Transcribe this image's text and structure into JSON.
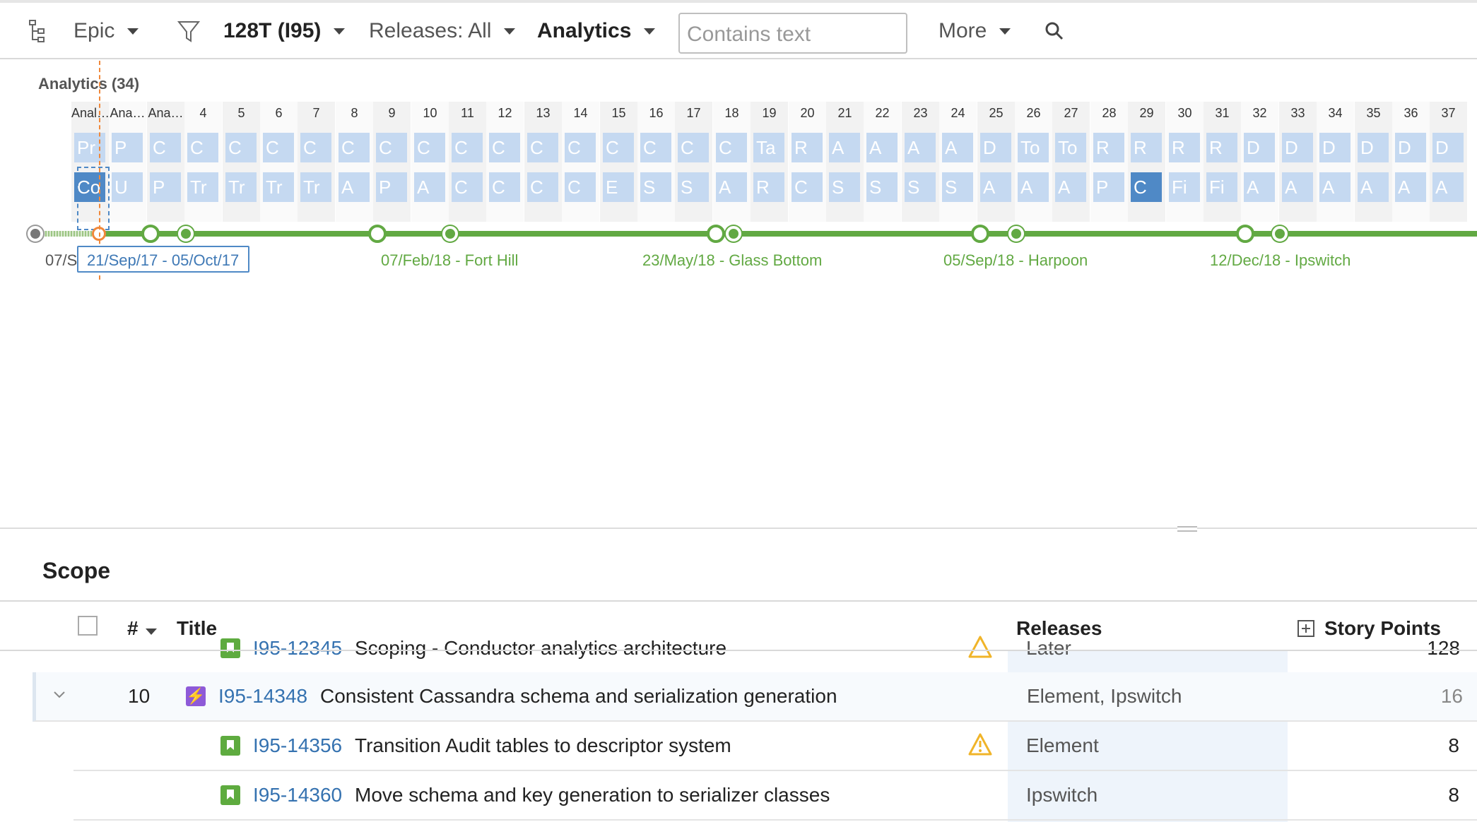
{
  "toolbar": {
    "hierarchy_icon": "hierarchy-icon",
    "epic_label": "Epic",
    "filter_icon": "funnel-icon",
    "project_label": "128T (I95)",
    "releases_label": "Releases: All",
    "team_label": "Analytics",
    "search_placeholder": "Contains text",
    "more_label": "More",
    "search_icon": "magnifier-icon"
  },
  "roadmap": {
    "title": "Analytics (34)",
    "columns": [
      "Anal…",
      "Ana…",
      "Ana…",
      "4",
      "5",
      "6",
      "7",
      "8",
      "9",
      "10",
      "11",
      "12",
      "13",
      "14",
      "15",
      "16",
      "17",
      "18",
      "19",
      "20",
      "21",
      "22",
      "23",
      "24",
      "25",
      "26",
      "27",
      "28",
      "29",
      "30",
      "31",
      "32",
      "33",
      "34",
      "35",
      "36",
      "37"
    ],
    "row1": [
      "Pr",
      "P",
      "C",
      "C",
      "C",
      "C",
      "C",
      "C",
      "C",
      "C",
      "C",
      "C",
      "C",
      "C",
      "C",
      "C",
      "C",
      "C",
      "Ta",
      "R",
      "A",
      "A",
      "A",
      "A",
      "D",
      "To",
      "To",
      "R",
      "R",
      "R",
      "R",
      "D",
      "D",
      "D",
      "D",
      "D",
      "D"
    ],
    "row2": [
      "Co",
      "U",
      "P",
      "Tr",
      "Tr",
      "Tr",
      "Tr",
      "A",
      "P",
      "A",
      "C",
      "C",
      "C",
      "C",
      "E",
      "S",
      "S",
      "A",
      "R",
      "C",
      "S",
      "S",
      "S",
      "S",
      "A",
      "A",
      "A",
      "P",
      "C",
      "Fi",
      "Fi",
      "A",
      "A",
      "A",
      "A",
      "A",
      "A"
    ],
    "timeline": {
      "start_label": "07/S",
      "current_label": "21/Sep/17 - 05/Oct/17",
      "milestones": [
        "07/Feb/18 - Fort Hill",
        "23/May/18 - Glass Bottom",
        "05/Sep/18 - Harpoon",
        "12/Dec/18 - Ipswitch"
      ]
    }
  },
  "scope": {
    "title": "Scope",
    "columns": {
      "number": "#",
      "title": "Title",
      "releases": "Releases",
      "story_points": "Story Points"
    },
    "partial_row": {
      "id": "I95-12345",
      "title": "Scoping - Conductor analytics architecture",
      "release": "Later",
      "points": "128"
    },
    "rows": [
      {
        "number": "10",
        "type": "epic",
        "id": "I95-14348",
        "title": "Consistent Cassandra schema and serialization generation",
        "releases": "Element, Ipswitch",
        "points": "16"
      },
      {
        "number": "",
        "type": "story",
        "id": "I95-14356",
        "title": "Transition Audit tables to descriptor system",
        "releases": "Element",
        "points": "8",
        "warning": true
      },
      {
        "number": "",
        "type": "story",
        "id": "I95-14360",
        "title": "Move schema and key generation to serializer classes",
        "releases": "Ipswitch",
        "points": "8"
      }
    ]
  }
}
